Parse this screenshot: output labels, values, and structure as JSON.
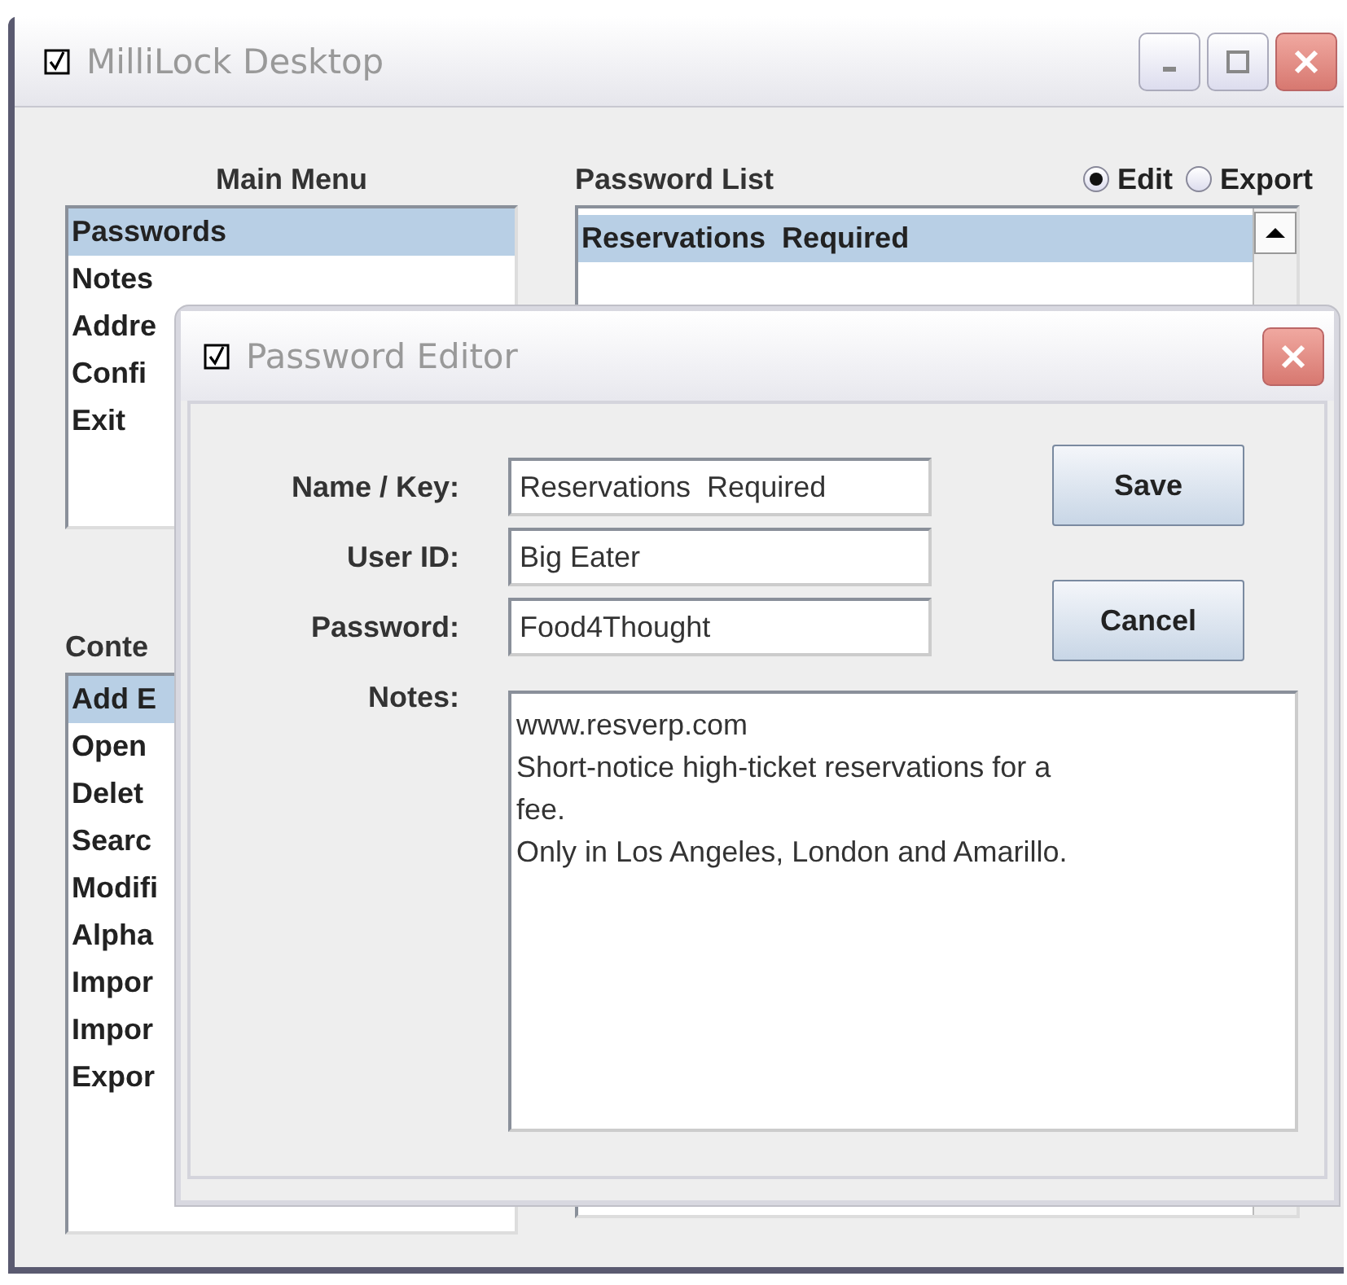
{
  "main_window": {
    "title": "MilliLock Desktop",
    "main_menu": {
      "heading": "Main Menu",
      "items": [
        {
          "label": "Passwords",
          "selected": true
        },
        {
          "label": "Notes",
          "selected": false
        },
        {
          "label": "Addre",
          "selected": false
        },
        {
          "label": "Confi",
          "selected": false
        },
        {
          "label": "Exit",
          "selected": false
        }
      ]
    },
    "password_list": {
      "heading": "Password List",
      "modes": [
        {
          "label": "Edit",
          "selected": true
        },
        {
          "label": "Export",
          "selected": false
        }
      ],
      "items": [
        {
          "label": "Reservations  Required",
          "selected": true
        }
      ]
    },
    "content_menu": {
      "heading": "Conte",
      "items": [
        {
          "label": "Add E",
          "selected": true
        },
        {
          "label": "Open",
          "selected": false
        },
        {
          "label": "Delet",
          "selected": false
        },
        {
          "label": "Searc",
          "selected": false
        },
        {
          "label": "Modifi",
          "selected": false
        },
        {
          "label": "Alpha",
          "selected": false
        },
        {
          "label": "Impor",
          "selected": false
        },
        {
          "label": "Impor",
          "selected": false
        },
        {
          "label": "Expor",
          "selected": false
        }
      ]
    }
  },
  "dialog": {
    "title": "Password Editor",
    "fields": [
      {
        "label": "Name / Key:",
        "value": "Reservations  Required"
      },
      {
        "label": "User ID:",
        "value": "Big Eater"
      },
      {
        "label": "Password:",
        "value": "Food4Thought"
      }
    ],
    "notes": {
      "label": "Notes:",
      "lines": [
        "www.resverp.com",
        "Short-notice high-ticket reservations for a",
        "fee.",
        "Only in Los Angeles, London and Amarillo."
      ]
    },
    "buttons": [
      "Save",
      "Cancel"
    ]
  }
}
